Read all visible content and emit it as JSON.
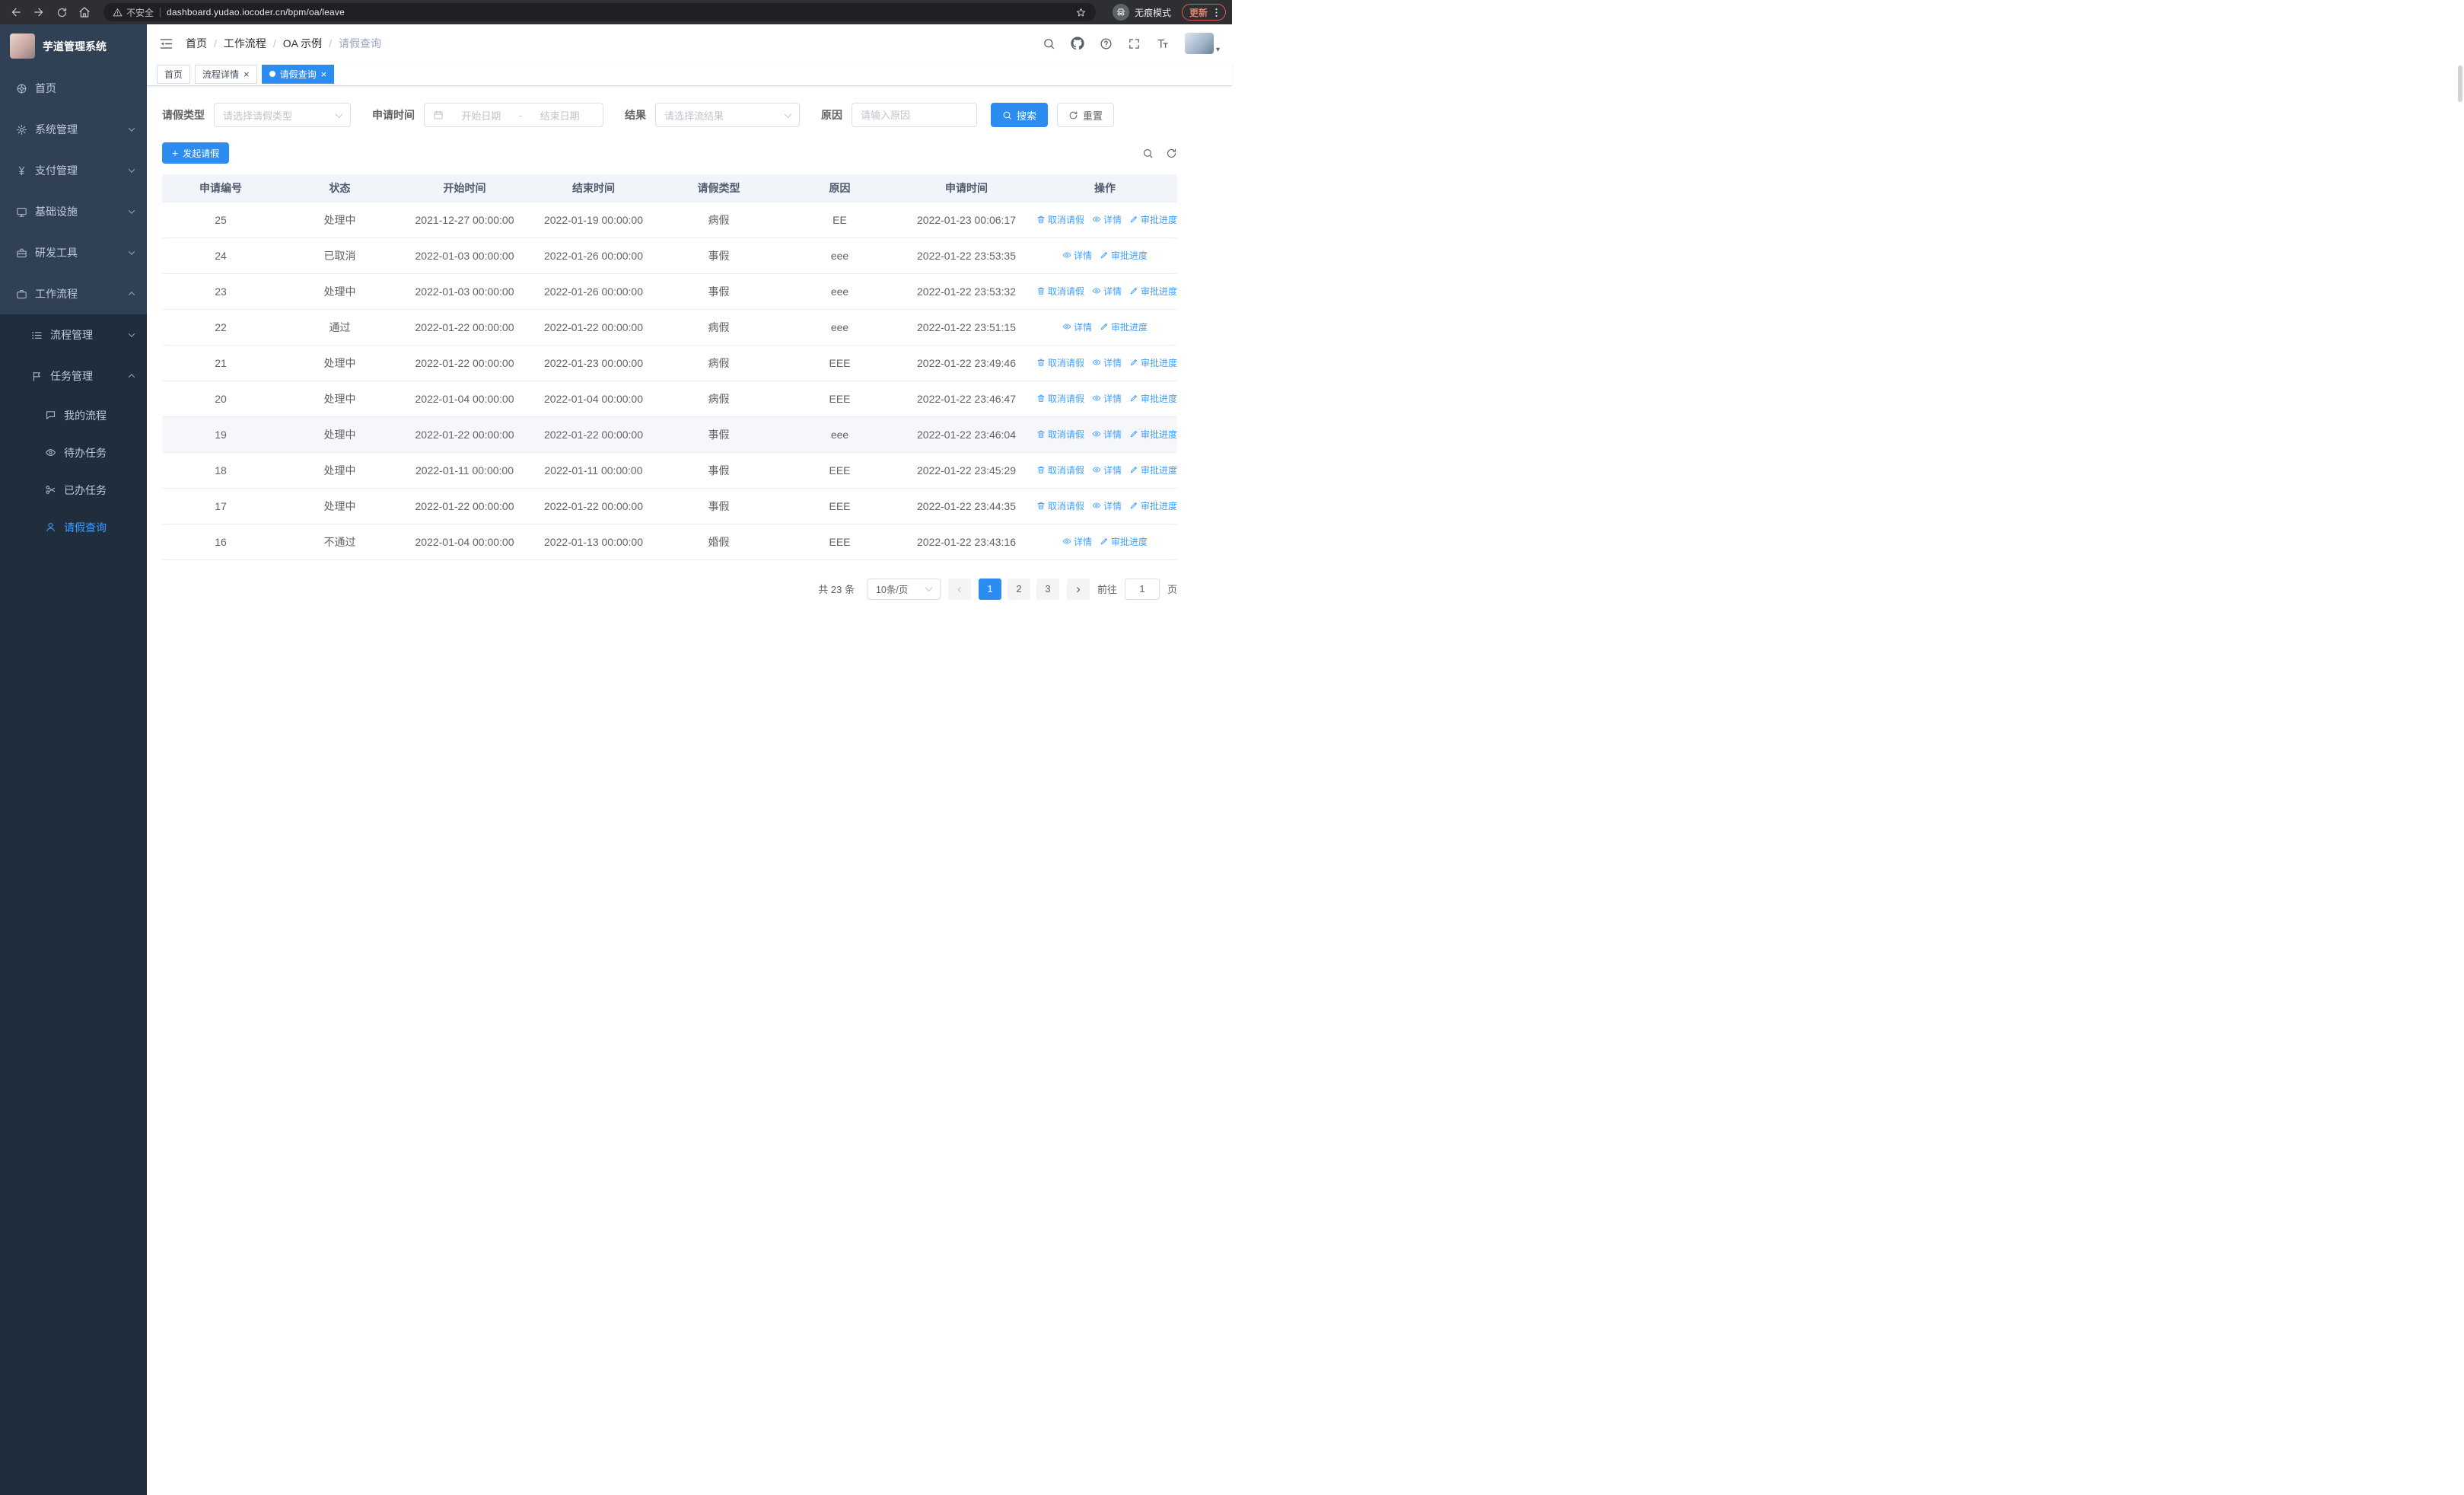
{
  "colors": {
    "primary": "#2d8cf0",
    "link": "#409eff",
    "sidebar_bg": "#304156",
    "submenu_bg": "#1f2d3d"
  },
  "browser": {
    "security_label": "不安全",
    "url": "dashboard.yudao.iocoder.cn/bpm/oa/leave",
    "incognito_label": "无痕模式",
    "update_label": "更新"
  },
  "sidebar": {
    "logo_title": "芋道管理系统",
    "items": [
      {
        "label": "首页",
        "icon": "home-icon",
        "level": 1,
        "arrow": "",
        "active": false
      },
      {
        "label": "系统管理",
        "icon": "gear-icon",
        "level": 1,
        "arrow": "down",
        "active": false
      },
      {
        "label": "支付管理",
        "icon": "yen-icon",
        "level": 1,
        "arrow": "down",
        "active": false
      },
      {
        "label": "基础设施",
        "icon": "infrastructure-icon",
        "level": 1,
        "arrow": "down",
        "active": false
      },
      {
        "label": "研发工具",
        "icon": "tools-icon",
        "level": 1,
        "arrow": "down",
        "active": false
      },
      {
        "label": "工作流程",
        "icon": "workflow-icon",
        "level": 1,
        "arrow": "up",
        "active": false
      },
      {
        "label": "流程管理",
        "icon": "process-icon",
        "level": 2,
        "arrow": "down",
        "active": false
      },
      {
        "label": "任务管理",
        "icon": "task-icon",
        "level": 2,
        "arrow": "up",
        "active": false
      },
      {
        "label": "我的流程",
        "icon": "my-process-icon",
        "level": 3,
        "arrow": "",
        "active": false
      },
      {
        "label": "待办任务",
        "icon": "todo-icon",
        "level": 3,
        "arrow": "",
        "active": false
      },
      {
        "label": "已办任务",
        "icon": "done-icon",
        "level": 3,
        "arrow": "",
        "active": false
      },
      {
        "label": "请假查询",
        "icon": "leave-user-icon",
        "level": 3,
        "arrow": "",
        "active": true
      }
    ]
  },
  "header": {
    "breadcrumb": [
      "首页",
      "工作流程",
      "OA 示例",
      "请假查询"
    ],
    "separator": "/"
  },
  "tabs": [
    {
      "label": "首页",
      "active": false,
      "closable": false
    },
    {
      "label": "流程详情",
      "active": false,
      "closable": true
    },
    {
      "label": "请假查询",
      "active": true,
      "closable": true
    }
  ],
  "filters": {
    "leave_type_label": "请假类型",
    "leave_type_placeholder": "请选择请假类型",
    "apply_time_label": "申请时间",
    "start_placeholder": "开始日期",
    "range_separator": "-",
    "end_placeholder": "结束日期",
    "result_label": "结果",
    "result_placeholder": "请选择流结果",
    "reason_label": "原因",
    "reason_placeholder": "请输入原因",
    "search_label": "搜索",
    "reset_label": "重置"
  },
  "toolbar": {
    "create_label": "发起请假"
  },
  "table": {
    "columns": [
      "申请编号",
      "状态",
      "开始时间",
      "结束时间",
      "请假类型",
      "原因",
      "申请时间",
      "操作"
    ],
    "action_labels": {
      "cancel": "取消请假",
      "detail": "详情",
      "progress": "审批进度"
    },
    "rows": [
      {
        "id": "25",
        "status": "处理中",
        "start": "2021-12-27 00:00:00",
        "end": "2022-01-19 00:00:00",
        "type": "病假",
        "reason": "EE",
        "apply": "2022-01-23 00:06:17",
        "actions": [
          "cancel",
          "detail",
          "progress"
        ],
        "highlighted": false
      },
      {
        "id": "24",
        "status": "已取消",
        "start": "2022-01-03 00:00:00",
        "end": "2022-01-26 00:00:00",
        "type": "事假",
        "reason": "eee",
        "apply": "2022-01-22 23:53:35",
        "actions": [
          "detail",
          "progress"
        ],
        "highlighted": false
      },
      {
        "id": "23",
        "status": "处理中",
        "start": "2022-01-03 00:00:00",
        "end": "2022-01-26 00:00:00",
        "type": "事假",
        "reason": "eee",
        "apply": "2022-01-22 23:53:32",
        "actions": [
          "cancel",
          "detail",
          "progress"
        ],
        "highlighted": false
      },
      {
        "id": "22",
        "status": "通过",
        "start": "2022-01-22 00:00:00",
        "end": "2022-01-22 00:00:00",
        "type": "病假",
        "reason": "eee",
        "apply": "2022-01-22 23:51:15",
        "actions": [
          "detail",
          "progress"
        ],
        "highlighted": false
      },
      {
        "id": "21",
        "status": "处理中",
        "start": "2022-01-22 00:00:00",
        "end": "2022-01-23 00:00:00",
        "type": "病假",
        "reason": "EEE",
        "apply": "2022-01-22 23:49:46",
        "actions": [
          "cancel",
          "detail",
          "progress"
        ],
        "highlighted": false
      },
      {
        "id": "20",
        "status": "处理中",
        "start": "2022-01-04 00:00:00",
        "end": "2022-01-04 00:00:00",
        "type": "病假",
        "reason": "EEE",
        "apply": "2022-01-22 23:46:47",
        "actions": [
          "cancel",
          "detail",
          "progress"
        ],
        "highlighted": false
      },
      {
        "id": "19",
        "status": "处理中",
        "start": "2022-01-22 00:00:00",
        "end": "2022-01-22 00:00:00",
        "type": "事假",
        "reason": "eee",
        "apply": "2022-01-22 23:46:04",
        "actions": [
          "cancel",
          "detail",
          "progress"
        ],
        "highlighted": true
      },
      {
        "id": "18",
        "status": "处理中",
        "start": "2022-01-11 00:00:00",
        "end": "2022-01-11 00:00:00",
        "type": "事假",
        "reason": "EEE",
        "apply": "2022-01-22 23:45:29",
        "actions": [
          "cancel",
          "detail",
          "progress"
        ],
        "highlighted": false
      },
      {
        "id": "17",
        "status": "处理中",
        "start": "2022-01-22 00:00:00",
        "end": "2022-01-22 00:00:00",
        "type": "事假",
        "reason": "EEE",
        "apply": "2022-01-22 23:44:35",
        "actions": [
          "cancel",
          "detail",
          "progress"
        ],
        "highlighted": false
      },
      {
        "id": "16",
        "status": "不通过",
        "start": "2022-01-04 00:00:00",
        "end": "2022-01-13 00:00:00",
        "type": "婚假",
        "reason": "EEE",
        "apply": "2022-01-22 23:43:16",
        "actions": [
          "detail",
          "progress"
        ],
        "highlighted": false
      }
    ]
  },
  "pagination": {
    "total_label": "共 23 条",
    "page_size_label": "10条/页",
    "pages": [
      "1",
      "2",
      "3"
    ],
    "active_page": "1",
    "goto_label": "前往",
    "goto_value": "1",
    "goto_suffix": "页"
  }
}
